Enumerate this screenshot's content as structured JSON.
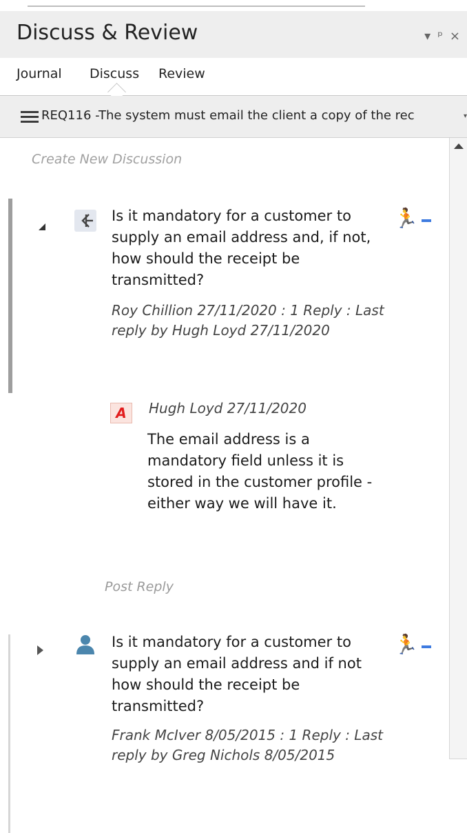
{
  "window": {
    "title": "Discuss & Review"
  },
  "tabs": [
    "Journal",
    "Discuss",
    "Review"
  ],
  "req": {
    "label": "REQ116 -The system must email the client a copy of the rec"
  },
  "discussion": {
    "create_new": "Create New Discussion",
    "post_reply": "Post Reply",
    "threads": [
      {
        "text": "Is it mandatory for a customer to supply an email address and, if not, how should the receipt be transmitted?",
        "meta": "Roy Chillion 27/11/2020 : 1 Reply : Last reply by Hugh Loyd 27/11/2020",
        "reply": {
          "icon_letter": "A",
          "author_date": "Hugh Loyd  27/11/2020",
          "text": "The email address is a mandatory field unless it is stored in the customer profile - either way we will have it."
        }
      },
      {
        "text": "Is it mandatory for a customer to supply an email address and if not how should the receipt be transmitted?",
        "meta": "Frank McIver 8/05/2015 : 1 Reply : Last reply by Greg Nichols 8/05/2015"
      }
    ]
  },
  "colors": {
    "accent": "#2f6bd8",
    "reply_icon_bg": "#fbe4df",
    "reply_icon_fg": "#e21d1d"
  }
}
